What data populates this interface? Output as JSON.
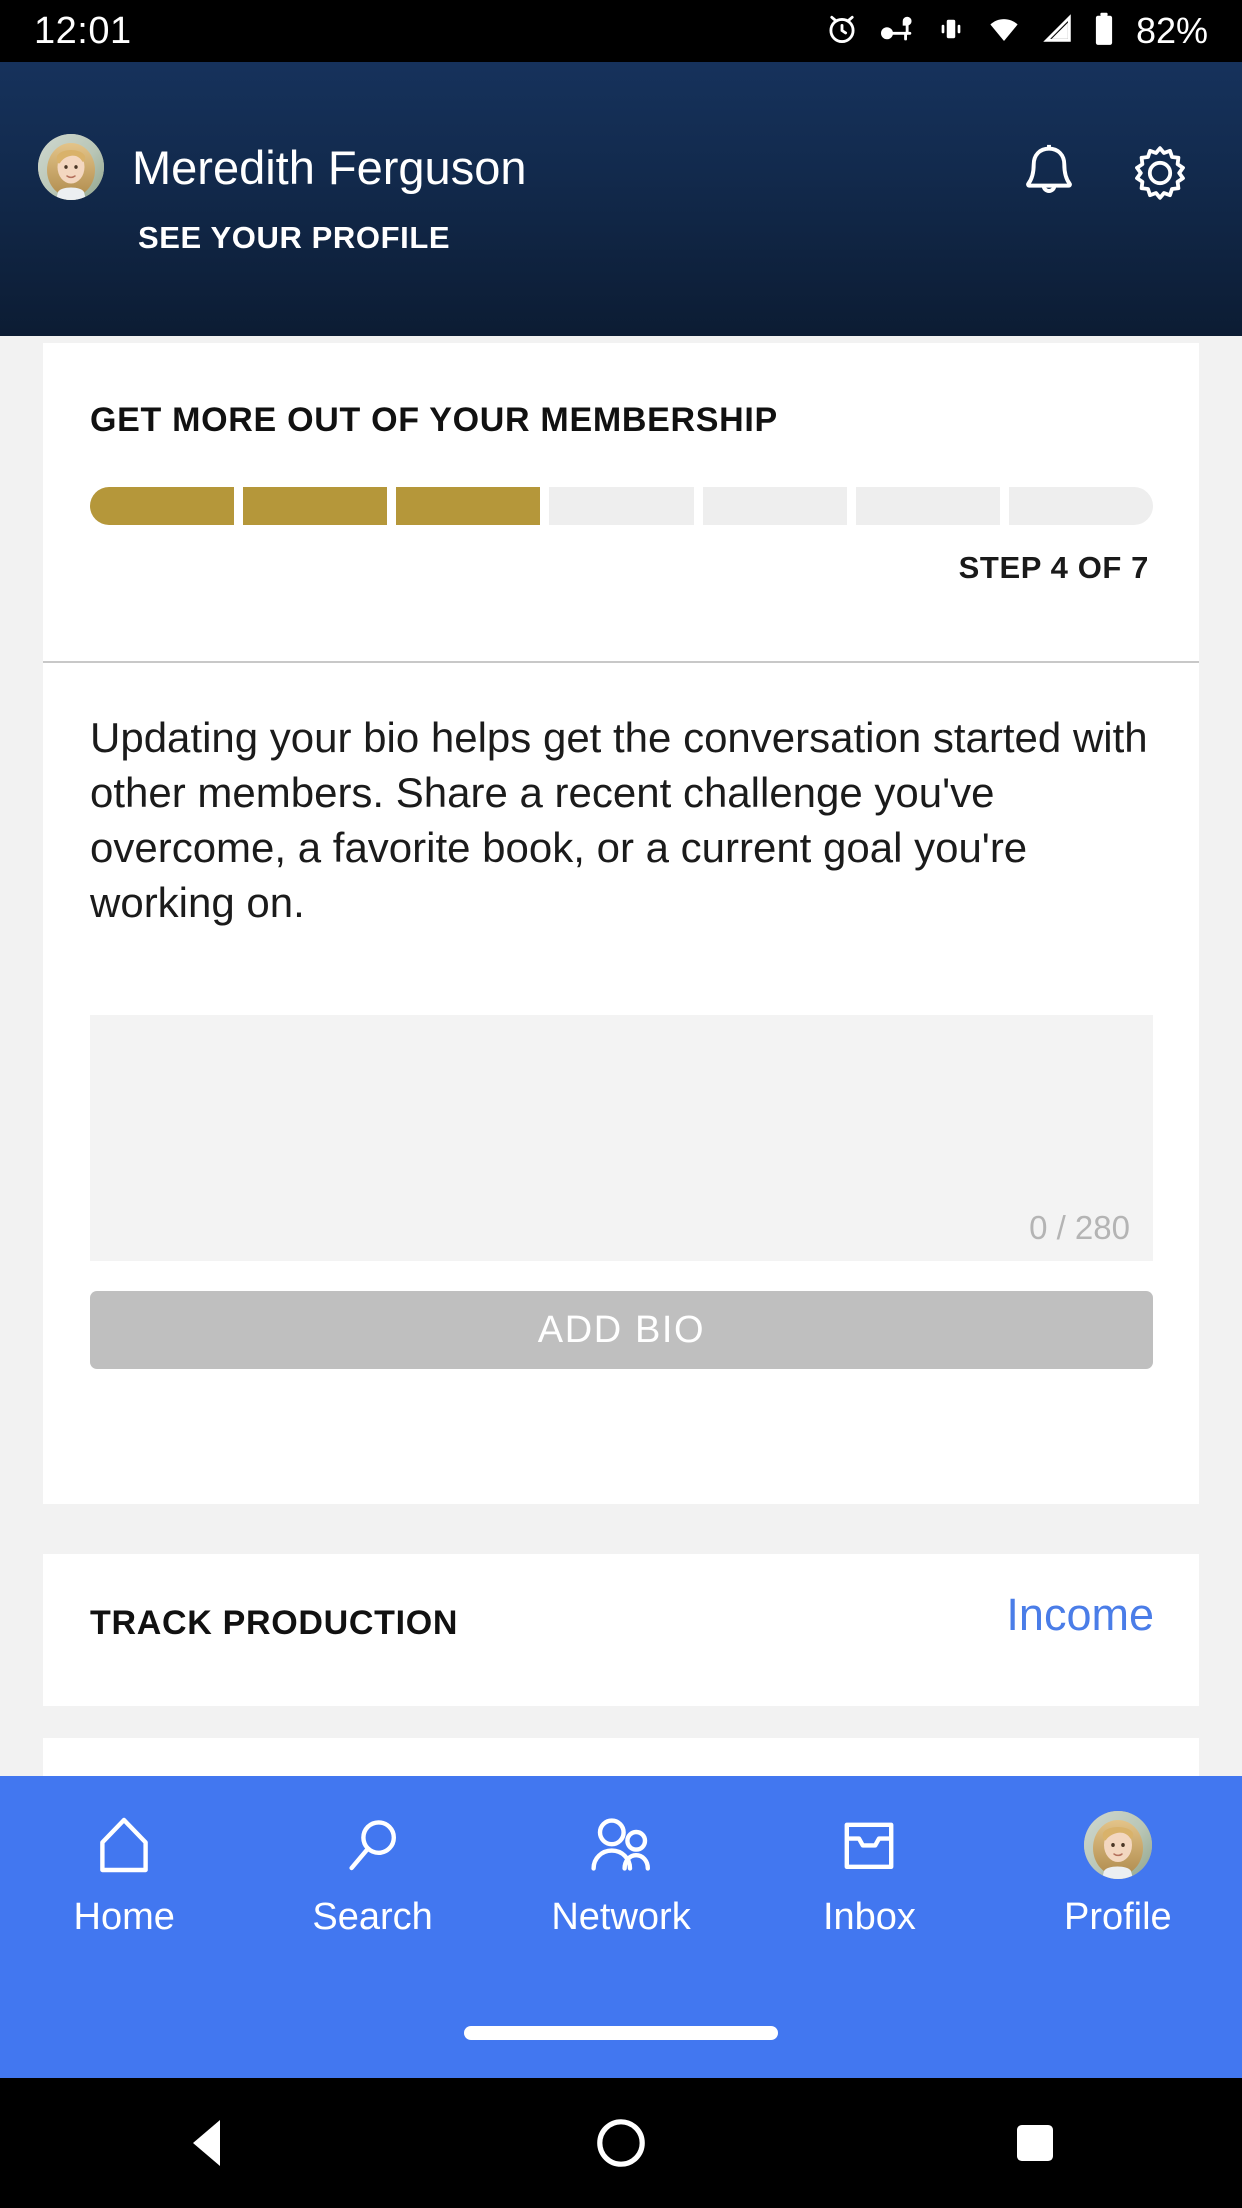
{
  "status_bar": {
    "time": "12:01",
    "battery_percent": "82%",
    "icons": [
      "alarm-icon",
      "vpn-key-icon",
      "vibrate-icon",
      "wifi-icon",
      "cellular-signal-icon",
      "battery-icon"
    ]
  },
  "header": {
    "user_name": "Meredith Ferguson",
    "see_profile_label": "SEE YOUR PROFILE",
    "avatar_alt": "user-avatar",
    "notifications_icon": "bell-icon",
    "settings_icon": "gear-icon",
    "background_color": "#122a4d"
  },
  "membership_card": {
    "title": "GET MORE OUT OF YOUR MEMBERSHIP",
    "step_label": "STEP 4 OF 7",
    "progress": {
      "total_steps": 7,
      "completed_steps": 3,
      "active_color": "#b5973a",
      "inactive_color": "#eeeeee"
    },
    "body_text": "Updating your bio helps get the conversation started with other members. Share a recent challenge you've overcome, a favorite book, or a current goal you're working on.",
    "bio_input": {
      "value": "",
      "placeholder": "",
      "counter": "0 / 280",
      "max_length": 280
    },
    "submit_button": {
      "label": "ADD BIO",
      "enabled": false,
      "color": "#bfbfbf"
    }
  },
  "track_card": {
    "title": "TRACK PRODUCTION",
    "link_label": "Income",
    "link_color": "#4a7de8"
  },
  "bottom_nav": {
    "background_color": "#4277f0",
    "items": [
      {
        "label": "Home",
        "icon": "home-icon"
      },
      {
        "label": "Search",
        "icon": "search-icon"
      },
      {
        "label": "Network",
        "icon": "people-icon"
      },
      {
        "label": "Inbox",
        "icon": "inbox-tray-icon"
      },
      {
        "label": "Profile",
        "icon": "avatar-icon"
      }
    ]
  },
  "system_nav": {
    "back": "back-triangle-icon",
    "home": "home-circle-icon",
    "recents": "recents-square-icon"
  }
}
